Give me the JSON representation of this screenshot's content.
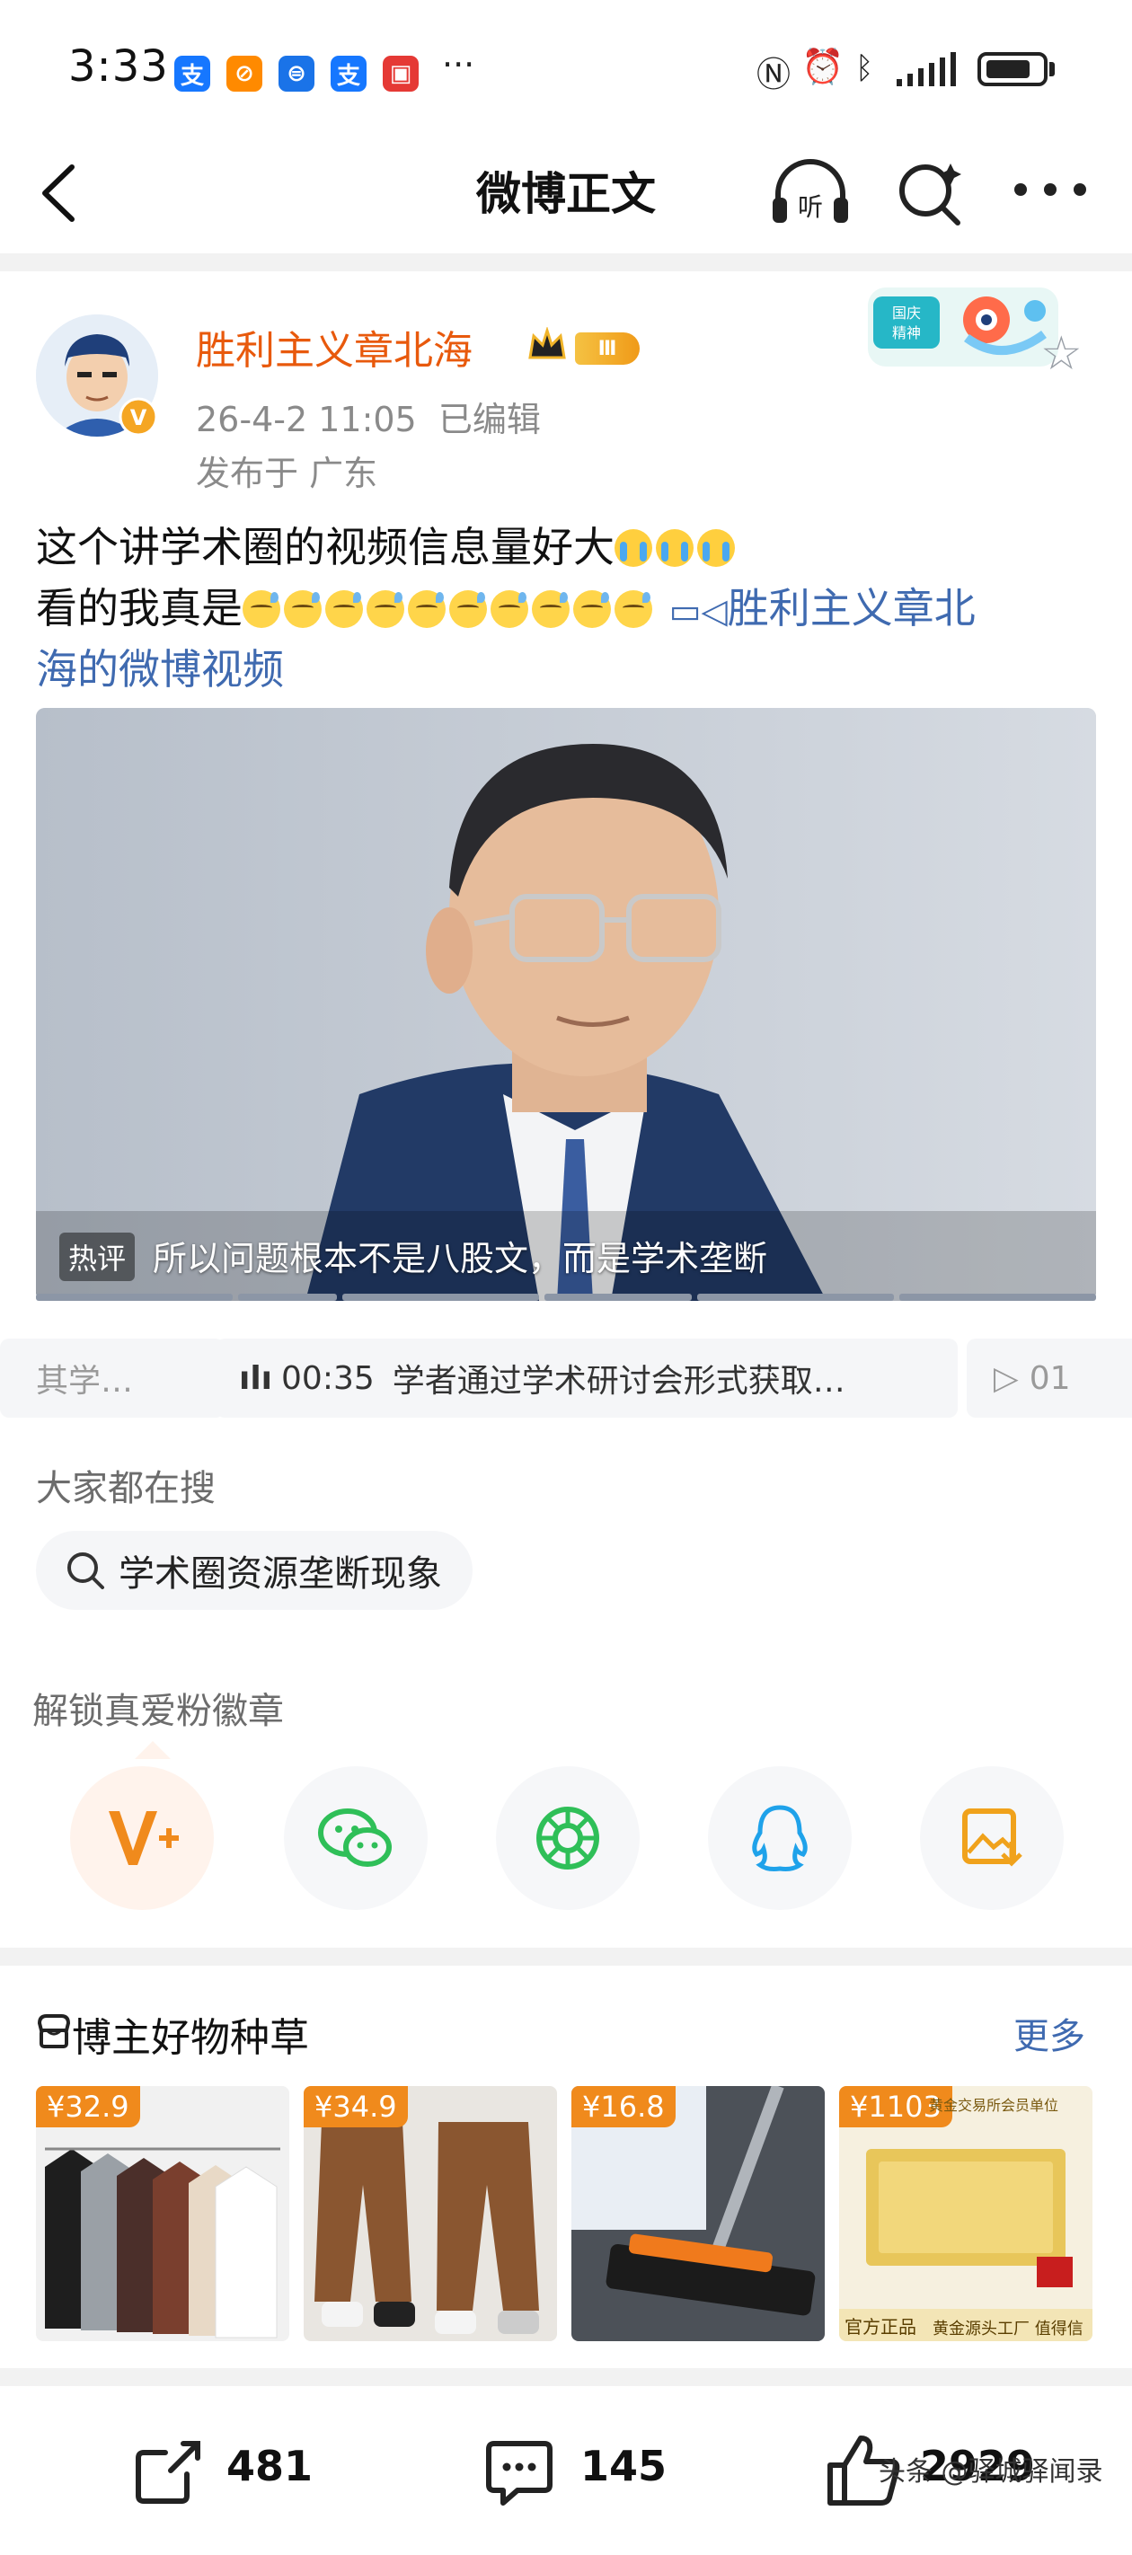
{
  "status_bar": {
    "time": "3:33",
    "more": "···",
    "apps": [
      {
        "name": "alipay-icon",
        "color": "#1677ff",
        "glyph": "支"
      },
      {
        "name": "app-orange-icon",
        "color": "#ff8a00",
        "glyph": "⊘"
      },
      {
        "name": "app-blue-icon",
        "color": "#1a73e8",
        "glyph": "⊜"
      },
      {
        "name": "alipay-icon-2",
        "color": "#1677ff",
        "glyph": "支"
      },
      {
        "name": "app-red-icon",
        "color": "#e53935",
        "glyph": "▣"
      }
    ],
    "battery_level": 0.78
  },
  "nav": {
    "title": "微博正文"
  },
  "post": {
    "username": "胜利主义章北海",
    "level_badge": "Ⅲ",
    "date": "26-4-2 11:05",
    "edited": "已编辑",
    "location": "发布于 广东",
    "text_line1": "这个讲学术圈的视频信息量好大",
    "text_line2": "看的我真是",
    "link_part1": "胜利主义章北",
    "link_part2": "海的微博视频",
    "video_hot_tag": "热评",
    "video_hot_comment": "所以问题根本不是八股文，而是学术垄断"
  },
  "chapters": [
    {
      "text": "其学…"
    },
    {
      "time": "00:35",
      "text": "学者通过学术研讨会形式获取…"
    },
    {
      "text": "01"
    }
  ],
  "search": {
    "title": "大家都在搜",
    "query": "学术圈资源垄断现象"
  },
  "unlock_label": "解锁真爱粉徽章",
  "goods": {
    "title": "博主好物种草",
    "more": "更多",
    "items": [
      {
        "price": "¥32.9",
        "caption": ""
      },
      {
        "price": "¥34.9",
        "caption": ""
      },
      {
        "price": "¥16.8",
        "caption": ""
      },
      {
        "price": "¥1103",
        "caption": "官方正品"
      }
    ],
    "item4_banner": "黄金交易所会员单位",
    "item4_footer": "黄金源头工厂 值得信赖"
  },
  "actions": {
    "repost": "481",
    "comment": "145",
    "like": "2929"
  },
  "watermark": "头条 @驿城驿闻录",
  "colors": {
    "username": "#e8590c",
    "link": "#3f6ab0",
    "price": "#f08a1c"
  }
}
